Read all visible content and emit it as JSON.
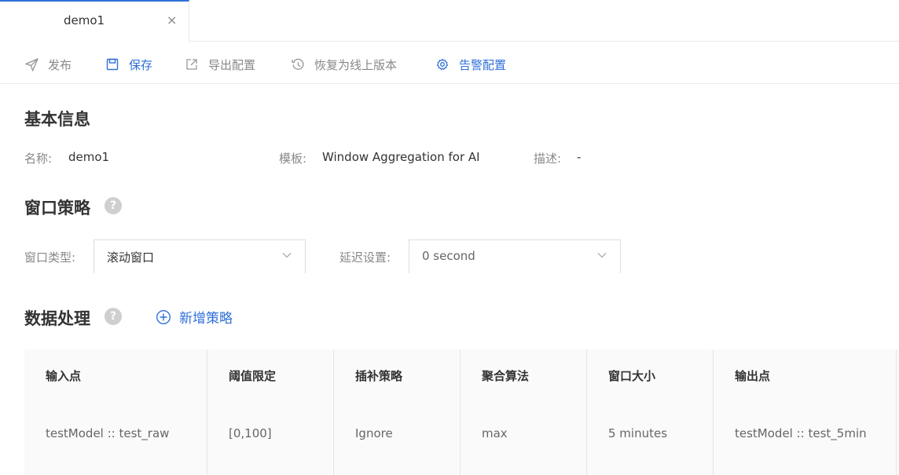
{
  "tab": {
    "label": "demo1",
    "close_glyph": "×"
  },
  "toolbar": {
    "publish": "发布",
    "save": "保存",
    "export": "导出配置",
    "restore": "恢复为线上版本",
    "alert": "告警配置"
  },
  "basic_info": {
    "title": "基本信息",
    "name_label": "名称:",
    "name_value": "demo1",
    "template_label": "模板:",
    "template_value": "Window Aggregation for AI",
    "desc_label": "描述:",
    "desc_value": "-"
  },
  "window_policy": {
    "title": "窗口策略",
    "help": "?",
    "type_label": "窗口类型:",
    "type_value": "滚动窗口",
    "delay_label": "延迟设置:",
    "delay_value": "0 second"
  },
  "data_processing": {
    "title": "数据处理",
    "help": "?",
    "add_label": "新增策略",
    "columns": [
      "输入点",
      "阈值限定",
      "插补策略",
      "聚合算法",
      "窗口大小",
      "输出点"
    ],
    "rows": [
      [
        "testModel :: test_raw",
        "[0,100]",
        "Ignore",
        "max",
        "5 minutes",
        "testModel :: test_5min"
      ]
    ]
  },
  "colors": {
    "accent": "#2f6fd8",
    "muted": "#888888",
    "help_bg": "#cfcfcf",
    "table_bg": "#fafafa"
  }
}
